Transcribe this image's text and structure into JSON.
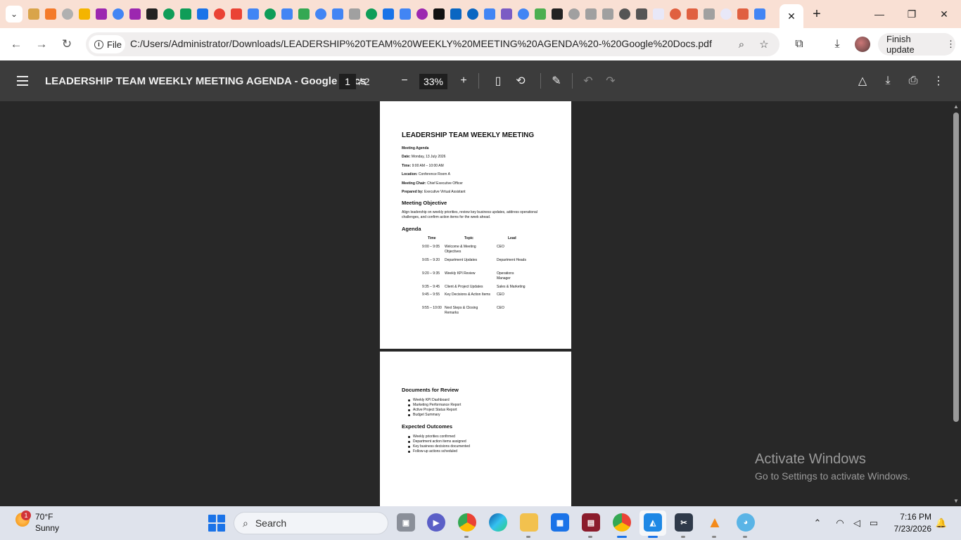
{
  "browser": {
    "active_tab_icon": "google-g",
    "close_tab_icon": "close-icon",
    "url": "C:/Users/Administrator/Downloads/LEADERSHIP%20TEAM%20WEEKLY%20MEETING%20AGENDA%20-%20Google%20Docs.pdf",
    "site_chip_label": "File",
    "finish_update_label": "Finish update"
  },
  "favicon_colors": [
    "#d9a44a",
    "#f47a2a",
    "#b0b0b0",
    "#f4b400",
    "#9c27b0",
    "#4285f4",
    "#9c27b0",
    "#222222",
    "#0f9d58",
    "#0f9d58",
    "#1a73e8",
    "#ea4335",
    "#ea4335",
    "#4285f4",
    "#0f9d58",
    "#4285f4",
    "#34a853",
    "#4285f4",
    "#4285f4",
    "#a0a0a0",
    "#0f9d58",
    "#1a73e8",
    "#4285f4",
    "#9c27b0",
    "#111111",
    "#0a66c2",
    "#0a66c2",
    "#4285f4",
    "#7b5cc4",
    "#4285f4",
    "#4caf50",
    "#222222",
    "#a0a0a0",
    "#a0a0a0",
    "#a0a0a0",
    "#555555",
    "#555555",
    "#e8e8f8",
    "#e06040",
    "#e06040",
    "#a0a0a0",
    "#e8e8f8",
    "#e06040",
    "#4285f4"
  ],
  "pdf": {
    "title": "LEADERSHIP TEAM WEEKLY MEETING AGENDA - Google Docs",
    "current_page": "1",
    "total_pages": "/  2",
    "zoom": "33%"
  },
  "document": {
    "heading": "LEADERSHIP TEAM WEEKLY MEETING",
    "subheading": "Meeting Agenda",
    "details": [
      {
        "label": "Date:",
        "value": "Monday, 13 July 2026"
      },
      {
        "label": "Time:",
        "value": "9:00 AM – 10:00 AM"
      },
      {
        "label": "Location:",
        "value": "Conference Room A"
      },
      {
        "label": "Meeting Chair:",
        "value": "Chief Executive Officer"
      },
      {
        "label": "Prepared by:",
        "value": "Executive Virtual Assistant"
      }
    ],
    "objective_title": "Meeting Objective",
    "objective_text": "Align leadership on weekly priorities, review key business updates, address operational challenges, and confirm action items for the week ahead.",
    "agenda_title": "Agenda",
    "agenda_headers": [
      "Time",
      "Topic",
      "Lead"
    ],
    "agenda_rows": [
      {
        "time": "9:00 – 9:05",
        "topic": "Welcome & Meeting Objectives",
        "lead": "CEO"
      },
      {
        "time": "9:05 – 9:20",
        "topic": "Department Updates",
        "lead": "Department Heads"
      },
      {
        "time": "9:20 – 9:35",
        "topic": "Weekly KPI Review",
        "lead": "Operations Manager"
      },
      {
        "time": "9:35 – 9:45",
        "topic": "Client & Project Updates",
        "lead": "Sales & Marketing"
      },
      {
        "time": "9:45 – 9:55",
        "topic": "Key Decisions & Action Items",
        "lead": "CEO"
      },
      {
        "time": "9:55 – 10:00",
        "topic": "Next Steps & Closing Remarks",
        "lead": "CEO"
      }
    ],
    "review_title": "Documents for Review",
    "review_items": [
      "Weekly KPI Dashboard",
      "Marketing Performance Report",
      "Active Project Status Report",
      "Budget Summary"
    ],
    "outcomes_title": "Expected Outcomes",
    "outcome_items": [
      "Weekly priorities confirmed",
      "Department action items assigned",
      "Key business decisions documented",
      "Follow-up actions scheduled"
    ]
  },
  "watermark": {
    "line1": "Activate Windows",
    "line2": "Go to Settings to activate Windows."
  },
  "taskbar": {
    "weather_temp": "70°F",
    "weather_cond": "Sunny",
    "weather_badge": "1",
    "search_label": "Search",
    "time": "7:16 PM",
    "date": "7/23/2026"
  }
}
